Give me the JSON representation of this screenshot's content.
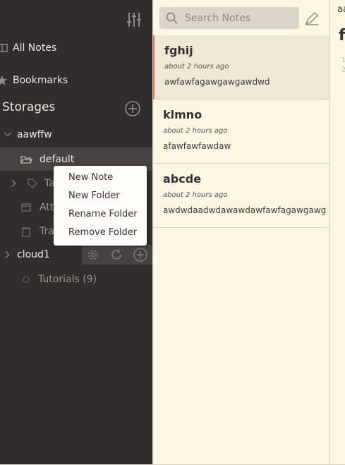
{
  "sidebar": {
    "nav": [
      {
        "label": "All Notes",
        "icon": "notebook-icon"
      },
      {
        "label": "Bookmarks",
        "icon": "star-icon"
      }
    ],
    "storages_title": "Storages",
    "storages": [
      {
        "name": "aawffw",
        "folder_label": "default",
        "children": [
          {
            "label": "Tag",
            "icon": "tag-icon"
          },
          {
            "label": "Atta",
            "icon": "attachment-icon"
          },
          {
            "label": "Tra",
            "icon": "trash-icon"
          }
        ]
      },
      {
        "name": "cloud1",
        "folder_label": "Tutorials (9)"
      }
    ]
  },
  "context_menu": {
    "items": [
      "New Note",
      "New Folder",
      "Rename Folder",
      "Remove Folder"
    ]
  },
  "notelist": {
    "search_placeholder": "Search Notes",
    "notes": [
      {
        "title": "fghij",
        "time": "about 2 hours ago",
        "body": "awfawfagawgawgawdwd"
      },
      {
        "title": "klmno",
        "time": "about 2 hours ago",
        "body": "afawfawfawdaw"
      },
      {
        "title": "abcde",
        "time": "about 2 hours ago",
        "body": "awdwdaadwdawawdawfawfagawgawg"
      }
    ]
  },
  "editor": {
    "tab_label": "aa",
    "title": "f",
    "line_numbers": [
      "1",
      "2"
    ]
  },
  "colors": {
    "sidebar_bg": "#2f2e2b",
    "notelist_bg": "#fdf6e3",
    "accent": "#e8793d"
  }
}
